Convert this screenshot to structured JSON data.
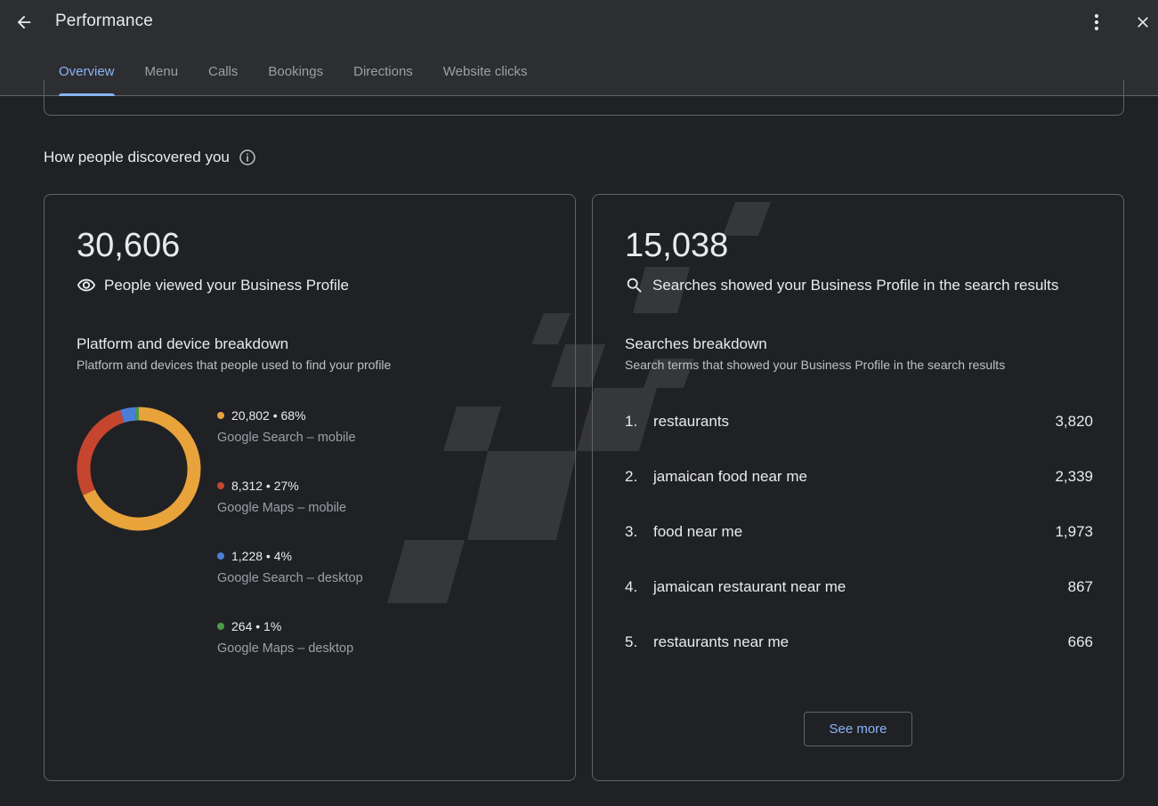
{
  "header": {
    "title": "Performance",
    "tabs": [
      {
        "label": "Overview",
        "active": true
      },
      {
        "label": "Menu"
      },
      {
        "label": "Calls"
      },
      {
        "label": "Bookings"
      },
      {
        "label": "Directions"
      },
      {
        "label": "Website clicks"
      }
    ]
  },
  "section": {
    "title": "How people discovered you"
  },
  "views_card": {
    "total": "30,606",
    "label": "People viewed your Business Profile",
    "breakdown_title": "Platform and device breakdown",
    "breakdown_desc": "Platform and devices that people used to find your profile",
    "items": [
      {
        "value": "20,802 • 68%",
        "name": "Google Search – mobile",
        "color": "#e8a33a",
        "count": 20802
      },
      {
        "value": "8,312 • 27%",
        "name": "Google Maps – mobile",
        "color": "#c6452f",
        "count": 8312
      },
      {
        "value": "1,228 • 4%",
        "name": "Google Search – desktop",
        "color": "#4a7fd9",
        "count": 1228
      },
      {
        "value": "264 • 1%",
        "name": "Google Maps – desktop",
        "color": "#4d9a48",
        "count": 264
      }
    ]
  },
  "searches_card": {
    "total": "15,038",
    "label": "Searches showed your Business Profile in the search results",
    "breakdown_title": "Searches breakdown",
    "breakdown_desc": "Search terms that showed your Business Profile in the search results",
    "items": [
      {
        "rank": "1.",
        "term": "restaurants",
        "count": "3,820"
      },
      {
        "rank": "2.",
        "term": "jamaican food near me",
        "count": "2,339"
      },
      {
        "rank": "3.",
        "term": "food near me",
        "count": "1,973"
      },
      {
        "rank": "4.",
        "term": "jamaican restaurant near me",
        "count": "867"
      },
      {
        "rank": "5.",
        "term": "restaurants near me",
        "count": "666"
      }
    ],
    "see_more_label": "See more"
  }
}
